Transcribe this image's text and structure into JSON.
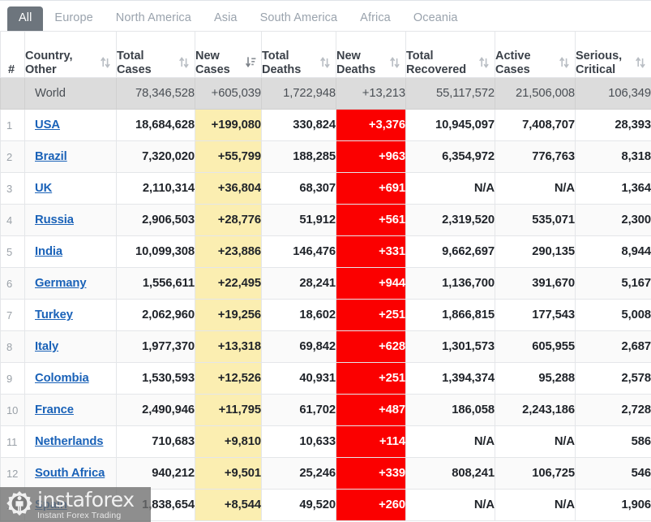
{
  "tabs": [
    {
      "label": "All",
      "active": true
    },
    {
      "label": "Europe",
      "active": false
    },
    {
      "label": "North America",
      "active": false
    },
    {
      "label": "Asia",
      "active": false
    },
    {
      "label": "South America",
      "active": false
    },
    {
      "label": "Africa",
      "active": false
    },
    {
      "label": "Oceania",
      "active": false
    }
  ],
  "columns": [
    {
      "key": "index",
      "line1": "#",
      "line2": "",
      "sort": "none"
    },
    {
      "key": "country",
      "line1": "Country,",
      "line2": "Other",
      "sort": "both"
    },
    {
      "key": "total_cases",
      "line1": "Total",
      "line2": "Cases",
      "sort": "both"
    },
    {
      "key": "new_cases",
      "line1": "New",
      "line2": "Cases",
      "sort": "desc-active"
    },
    {
      "key": "total_deaths",
      "line1": "Total",
      "line2": "Deaths",
      "sort": "both"
    },
    {
      "key": "new_deaths",
      "line1": "New",
      "line2": "Deaths",
      "sort": "both"
    },
    {
      "key": "total_recovered",
      "line1": "Total",
      "line2": "Recovered",
      "sort": "both"
    },
    {
      "key": "active_cases",
      "line1": "Active",
      "line2": "Cases",
      "sort": "both"
    },
    {
      "key": "serious",
      "line1": "Serious,",
      "line2": "Critical",
      "sort": "both"
    }
  ],
  "world_row": {
    "index": "",
    "country": "World",
    "total_cases": "78,346,528",
    "new_cases": "+605,039",
    "total_deaths": "1,722,948",
    "new_deaths": "+13,213",
    "total_recovered": "55,117,572",
    "active_cases": "21,506,008",
    "serious": "106,349"
  },
  "rows": [
    {
      "index": "1",
      "country": "USA",
      "total_cases": "18,684,628",
      "new_cases": "+199,080",
      "total_deaths": "330,824",
      "new_deaths": "+3,376",
      "total_recovered": "10,945,097",
      "active_cases": "7,408,707",
      "serious": "28,393"
    },
    {
      "index": "2",
      "country": "Brazil",
      "total_cases": "7,320,020",
      "new_cases": "+55,799",
      "total_deaths": "188,285",
      "new_deaths": "+963",
      "total_recovered": "6,354,972",
      "active_cases": "776,763",
      "serious": "8,318"
    },
    {
      "index": "3",
      "country": "UK",
      "total_cases": "2,110,314",
      "new_cases": "+36,804",
      "total_deaths": "68,307",
      "new_deaths": "+691",
      "total_recovered": "N/A",
      "active_cases": "N/A",
      "serious": "1,364"
    },
    {
      "index": "4",
      "country": "Russia",
      "total_cases": "2,906,503",
      "new_cases": "+28,776",
      "total_deaths": "51,912",
      "new_deaths": "+561",
      "total_recovered": "2,319,520",
      "active_cases": "535,071",
      "serious": "2,300"
    },
    {
      "index": "5",
      "country": "India",
      "total_cases": "10,099,308",
      "new_cases": "+23,886",
      "total_deaths": "146,476",
      "new_deaths": "+331",
      "total_recovered": "9,662,697",
      "active_cases": "290,135",
      "serious": "8,944"
    },
    {
      "index": "6",
      "country": "Germany",
      "total_cases": "1,556,611",
      "new_cases": "+22,495",
      "total_deaths": "28,241",
      "new_deaths": "+944",
      "total_recovered": "1,136,700",
      "active_cases": "391,670",
      "serious": "5,167"
    },
    {
      "index": "7",
      "country": "Turkey",
      "total_cases": "2,062,960",
      "new_cases": "+19,256",
      "total_deaths": "18,602",
      "new_deaths": "+251",
      "total_recovered": "1,866,815",
      "active_cases": "177,543",
      "serious": "5,008"
    },
    {
      "index": "8",
      "country": "Italy",
      "total_cases": "1,977,370",
      "new_cases": "+13,318",
      "total_deaths": "69,842",
      "new_deaths": "+628",
      "total_recovered": "1,301,573",
      "active_cases": "605,955",
      "serious": "2,687"
    },
    {
      "index": "9",
      "country": "Colombia",
      "total_cases": "1,530,593",
      "new_cases": "+12,526",
      "total_deaths": "40,931",
      "new_deaths": "+251",
      "total_recovered": "1,394,374",
      "active_cases": "95,288",
      "serious": "2,578"
    },
    {
      "index": "10",
      "country": "France",
      "total_cases": "2,490,946",
      "new_cases": "+11,795",
      "total_deaths": "61,702",
      "new_deaths": "+487",
      "total_recovered": "186,058",
      "active_cases": "2,243,186",
      "serious": "2,728"
    },
    {
      "index": "11",
      "country": "Netherlands",
      "total_cases": "710,683",
      "new_cases": "+9,810",
      "total_deaths": "10,633",
      "new_deaths": "+114",
      "total_recovered": "N/A",
      "active_cases": "N/A",
      "serious": "586"
    },
    {
      "index": "12",
      "country": "South Africa",
      "total_cases": "940,212",
      "new_cases": "+9,501",
      "total_deaths": "25,246",
      "new_deaths": "+339",
      "total_recovered": "808,241",
      "active_cases": "106,725",
      "serious": "546"
    },
    {
      "index": "13",
      "country": "Spain",
      "total_cases": "1,838,654",
      "new_cases": "+8,544",
      "total_deaths": "49,520",
      "new_deaths": "+260",
      "total_recovered": "N/A",
      "active_cases": "N/A",
      "serious": "1,906"
    }
  ],
  "watermark": {
    "title": "instaforex",
    "subtitle": "Instant Forex Trading"
  },
  "colors": {
    "active_tab_bg": "#6d757d",
    "new_cases_bg": "#fbeeb1",
    "new_deaths_bg": "#fb0000",
    "world_row_bg": "#dcdcdc",
    "link": "#1a62b8"
  }
}
